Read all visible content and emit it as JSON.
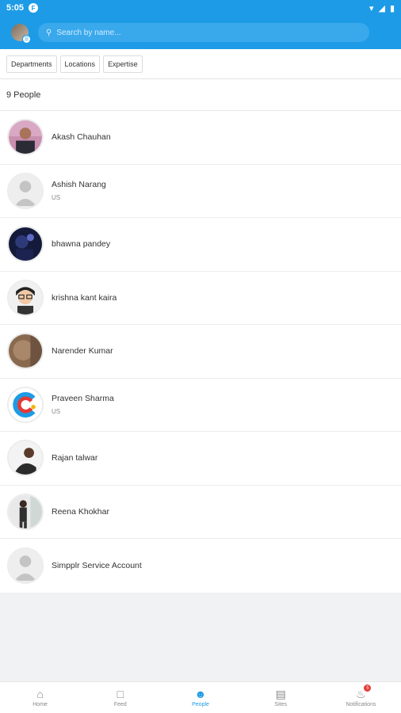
{
  "status_bar": {
    "time": "5:05",
    "app_badge": "F"
  },
  "header": {
    "search_placeholder": "Search by name..."
  },
  "filters": [
    "Departments",
    "Locations",
    "Expertise"
  ],
  "people_count": "9 People",
  "people": [
    {
      "name": "Akash Chauhan",
      "location": "",
      "avatar": "photo-dark-suit"
    },
    {
      "name": "Ashish Narang",
      "location": "US",
      "avatar": "default-silhouette"
    },
    {
      "name": "bhawna pandey",
      "location": "",
      "avatar": "photo-dark-blue"
    },
    {
      "name": "krishna kant kaira",
      "location": "",
      "avatar": "cartoon-glasses"
    },
    {
      "name": "Narender Kumar",
      "location": "",
      "avatar": "photo-brown"
    },
    {
      "name": "Praveen Sharma",
      "location": "US",
      "avatar": "c-logo"
    },
    {
      "name": "Rajan talwar",
      "location": "",
      "avatar": "photo-light"
    },
    {
      "name": "Reena Khokhar",
      "location": "",
      "avatar": "photo-standing"
    },
    {
      "name": "Simpplr Service Account",
      "location": "",
      "avatar": "default-silhouette"
    }
  ],
  "nav": {
    "home": "Home",
    "feed": "Feed",
    "people": "People",
    "sites": "Sites",
    "notifications": "Notifications",
    "notification_count": "5"
  },
  "colors": {
    "accent": "#1d9be6",
    "badge": "#e53935"
  }
}
